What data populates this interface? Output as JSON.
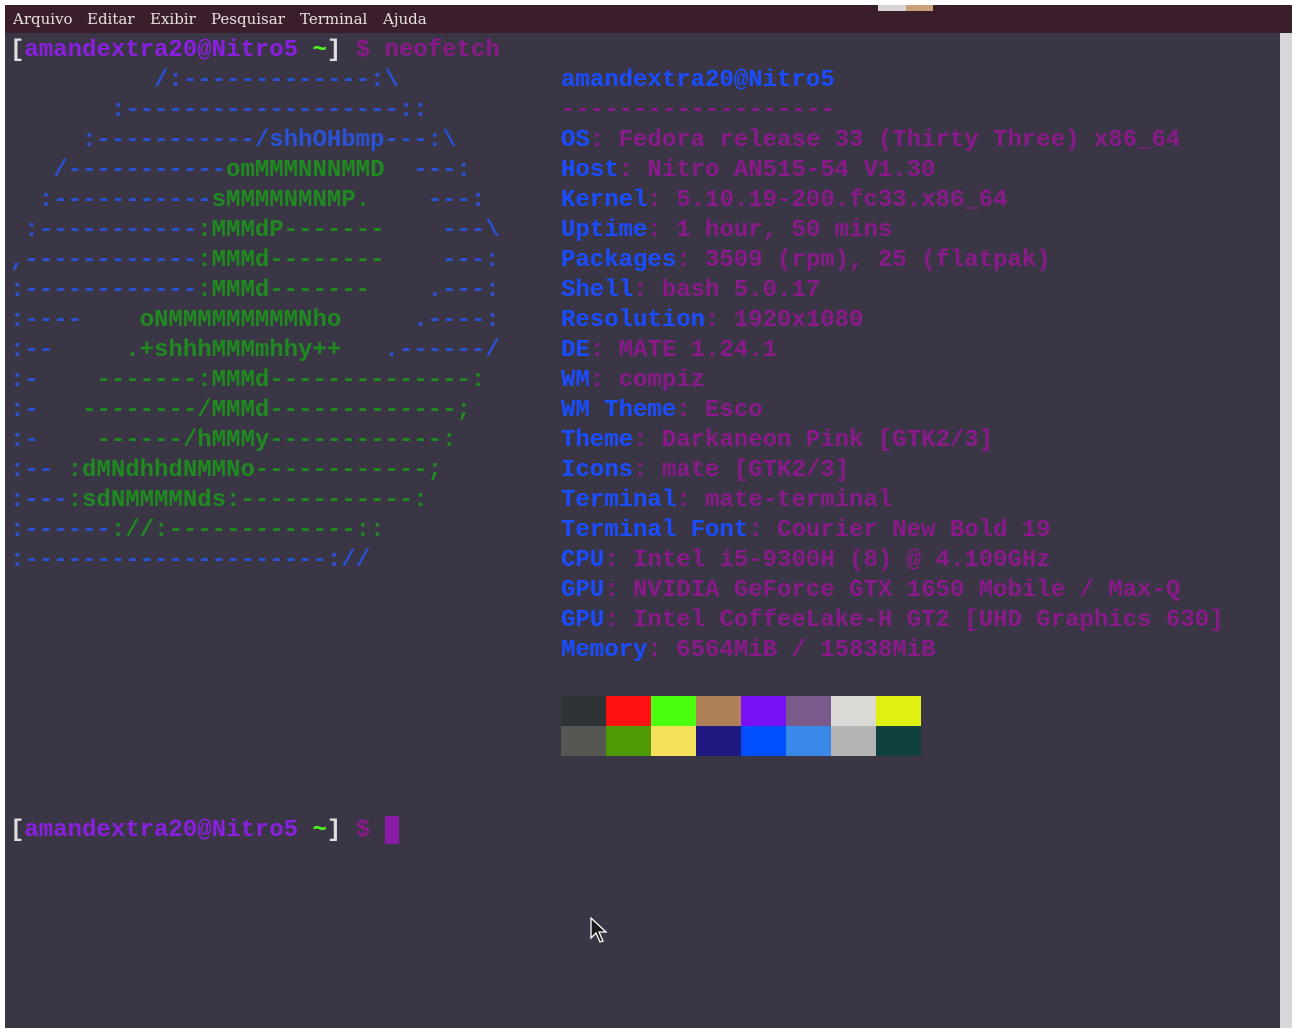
{
  "menu": [
    "Arquivo",
    "Editar",
    "Exibir",
    "Pesquisar",
    "Terminal",
    "Ajuda"
  ],
  "prompt": {
    "user_host": "amandextra20@Nitro5",
    "dir": "~",
    "dollar": "$",
    "command": "neofetch"
  },
  "ascii_art": [
    [
      [
        "b",
        "          /:-------------:\\"
      ]
    ],
    [
      [
        "b",
        "       :-------------------::"
      ]
    ],
    [
      [
        "b",
        "     :-----------/shhOHbmp---:\\"
      ]
    ],
    [
      [
        "b",
        "   /-----------"
      ],
      [
        "g",
        "omMMMNNNMMD"
      ],
      [
        "b",
        "  ---:"
      ]
    ],
    [
      [
        "b",
        "  :-----------"
      ],
      [
        "g",
        "sMMMMNMNMP."
      ],
      [
        "b",
        "    ---:"
      ]
    ],
    [
      [
        "b",
        " :-----------"
      ],
      [
        "g",
        ":MMMdP-------"
      ],
      [
        "b",
        "    ---\\"
      ]
    ],
    [
      [
        "b",
        ",------------"
      ],
      [
        "g",
        ":MMMd--------"
      ],
      [
        "b",
        "    ---:"
      ]
    ],
    [
      [
        "b",
        ":------------"
      ],
      [
        "g",
        ":MMMd-------"
      ],
      [
        "b",
        "    .---:"
      ]
    ],
    [
      [
        "b",
        ":----    "
      ],
      [
        "g",
        "oNMMMMMMMMMNho"
      ],
      [
        "b",
        "     .----:"
      ]
    ],
    [
      [
        "b",
        ":--     "
      ],
      [
        "g",
        ".+shhhMMMmhhy++"
      ],
      [
        "b",
        "   .------/"
      ]
    ],
    [
      [
        "b",
        ":-    "
      ],
      [
        "g",
        "-------:MMMd--------------:"
      ]
    ],
    [
      [
        "b",
        ":-   "
      ],
      [
        "g",
        "--------/MMMd-------------;"
      ]
    ],
    [
      [
        "b",
        ":-    "
      ],
      [
        "g",
        "------/hMMMy------------:"
      ]
    ],
    [
      [
        "b",
        ":-- "
      ],
      [
        "g",
        ":dMNdhhdNMMNo------------;"
      ]
    ],
    [
      [
        "b",
        ":---"
      ],
      [
        "g",
        ":sdNMMMMNds:------------:"
      ]
    ],
    [
      [
        "b",
        ":------"
      ],
      [
        "g",
        "://:-------------::"
      ]
    ],
    [
      [
        "b",
        ":---------------------://"
      ]
    ]
  ],
  "info": {
    "title": "amandextra20@Nitro5",
    "separator": "-------------------",
    "rows": [
      {
        "key": "OS",
        "value": "Fedora release 33 (Thirty Three) x86_64"
      },
      {
        "key": "Host",
        "value": "Nitro AN515-54 V1.30"
      },
      {
        "key": "Kernel",
        "value": "5.10.19-200.fc33.x86_64"
      },
      {
        "key": "Uptime",
        "value": "1 hour, 50 mins"
      },
      {
        "key": "Packages",
        "value": "3509 (rpm), 25 (flatpak)"
      },
      {
        "key": "Shell",
        "value": "bash 5.0.17"
      },
      {
        "key": "Resolution",
        "value": "1920x1080"
      },
      {
        "key": "DE",
        "value": "MATE 1.24.1"
      },
      {
        "key": "WM",
        "value": "compiz"
      },
      {
        "key": "WM Theme",
        "value": "Esco"
      },
      {
        "key": "Theme",
        "value": "Darkaneon Pink [GTK2/3]"
      },
      {
        "key": "Icons",
        "value": "mate [GTK2/3]"
      },
      {
        "key": "Terminal",
        "value": "mate-terminal"
      },
      {
        "key": "Terminal Font",
        "value": "Courier New Bold 19"
      },
      {
        "key": "CPU",
        "value": "Intel i5-9300H (8) @ 4.100GHz"
      },
      {
        "key": "GPU",
        "value": "NVIDIA GeForce GTX 1650 Mobile / Max-Q"
      },
      {
        "key": "GPU",
        "value": "Intel CoffeeLake-H GT2 [UHD Graphics 630]"
      },
      {
        "key": "Memory",
        "value": "6564MiB / 15838MiB"
      }
    ]
  },
  "palette": {
    "row1": [
      "#2e3436",
      "#ff1010",
      "#4bff10",
      "#b08058",
      "#7a10f5",
      "#7a5a8a",
      "#dcdad6",
      "#e0f010"
    ],
    "row2": [
      "#555753",
      "#4e9a06",
      "#f5e05a",
      "#201a80",
      "#0050ff",
      "#3a88e8",
      "#b4b4b4",
      "#104040"
    ]
  }
}
